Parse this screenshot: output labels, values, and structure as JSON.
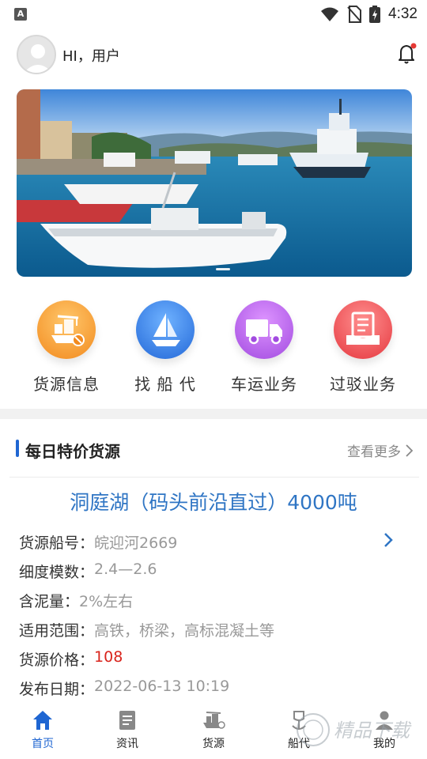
{
  "status_bar": {
    "badge": "A",
    "time": "4:32"
  },
  "header": {
    "greeting": "HI，用户",
    "notification_dot_color": "#e53935"
  },
  "quick_entries": [
    {
      "label": "货源信息",
      "icon": "crane-ship-icon",
      "color": "#f7a33e"
    },
    {
      "label": "找 船 代",
      "icon": "sailboat-icon",
      "color": "#3c86ea"
    },
    {
      "label": "车运业务",
      "icon": "truck-icon",
      "color": "#b35ee6"
    },
    {
      "label": "过驳业务",
      "icon": "document-tray-icon",
      "color": "#ef5257"
    }
  ],
  "daily_section": {
    "title": "每日特价货源",
    "more_label": "查看更多"
  },
  "cargo": {
    "title": "洞庭湖（码头前沿直过）4000吨",
    "rows": [
      {
        "key": "货源船号：",
        "value": "皖迎河2669"
      },
      {
        "key": "细度模数：",
        "value": "2.4—2.6"
      },
      {
        "key": "含泥量：",
        "value": "2%左右"
      },
      {
        "key": "适用范围：",
        "value": "高铁，桥梁，高标混凝土等"
      },
      {
        "key": "货源价格：",
        "value": "108"
      },
      {
        "key": "发布日期：",
        "value": "2022-06-13 10:19"
      }
    ]
  },
  "tabbar": [
    {
      "label": "首页",
      "icon": "home-icon",
      "active": true
    },
    {
      "label": "资讯",
      "icon": "news-icon",
      "active": false
    },
    {
      "label": "货源",
      "icon": "cargo-ship-icon",
      "active": false
    },
    {
      "label": "船代",
      "icon": "ship-agent-icon",
      "active": false
    },
    {
      "label": "我的",
      "icon": "profile-icon",
      "active": false
    }
  ],
  "colors": {
    "accent": "#1f66d2",
    "price": "#d9241c",
    "cargo_title": "#2f75c4"
  },
  "watermark": "精品下载"
}
